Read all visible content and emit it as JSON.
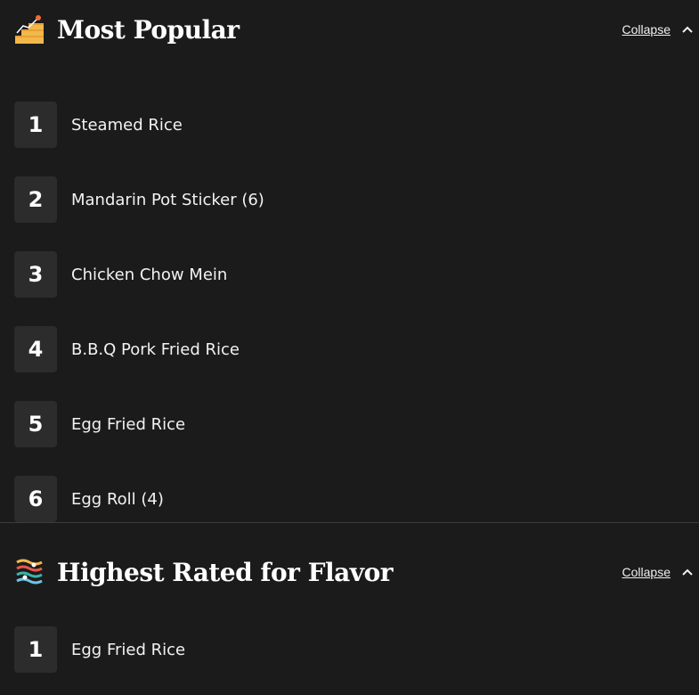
{
  "sections": [
    {
      "title": "Most Popular",
      "icon": "stairs-chart-icon",
      "collapse_label": "Collapse",
      "items": [
        {
          "rank": "1",
          "name": "Steamed Rice"
        },
        {
          "rank": "2",
          "name": "Mandarin Pot Sticker (6)"
        },
        {
          "rank": "3",
          "name": "Chicken Chow Mein"
        },
        {
          "rank": "4",
          "name": "B.B.Q Pork Fried Rice"
        },
        {
          "rank": "5",
          "name": "Egg Fried Rice"
        },
        {
          "rank": "6",
          "name": "Egg Roll (4)"
        }
      ]
    },
    {
      "title": "Highest Rated for Flavor",
      "icon": "flavor-waves-icon",
      "collapse_label": "Collapse",
      "items": [
        {
          "rank": "1",
          "name": "Egg Fried Rice"
        }
      ]
    }
  ],
  "colors": {
    "background": "#1c1b1b",
    "rank_box": "#2c2c2c",
    "divider": "#3c3c3c"
  }
}
